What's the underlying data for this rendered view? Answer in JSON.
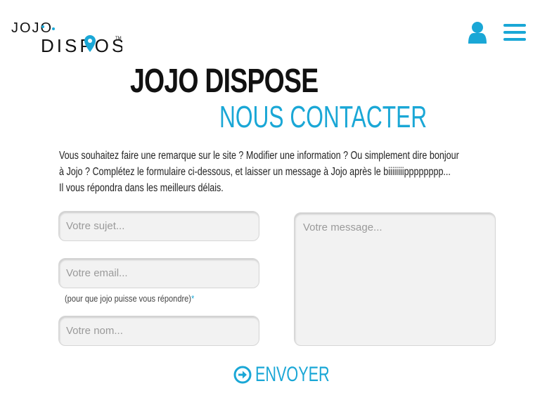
{
  "header": {
    "logo": {
      "line1": "JOJO",
      "line2": "DISPOSE"
    },
    "icons": {
      "user": "user-icon",
      "menu": "hamburger-menu-icon"
    },
    "accent": "#1aa7d6"
  },
  "page": {
    "title": "JOJO DISPOSE",
    "subtitle": "NOUS CONTACTER",
    "intro": [
      "Vous souhaitez faire une remarque sur le site ? Modifier une information ? Ou simplement dire bonjour",
      "à Jojo ? Complétez le formulaire ci-dessous, et laisser un message à Jojo après le biiiiiiiipppppppp...",
      "Il vous répondra dans les meilleurs délais."
    ]
  },
  "form": {
    "subject_placeholder": "Votre sujet...",
    "email_placeholder": "Votre email...",
    "email_hint": "(pour que jojo puisse vous répondre)",
    "required_mark": "*",
    "name_placeholder": "Votre nom...",
    "message_placeholder": "Votre message...",
    "send_label": "ENVOYER",
    "send_icon": "arrow-circle-right-icon"
  }
}
